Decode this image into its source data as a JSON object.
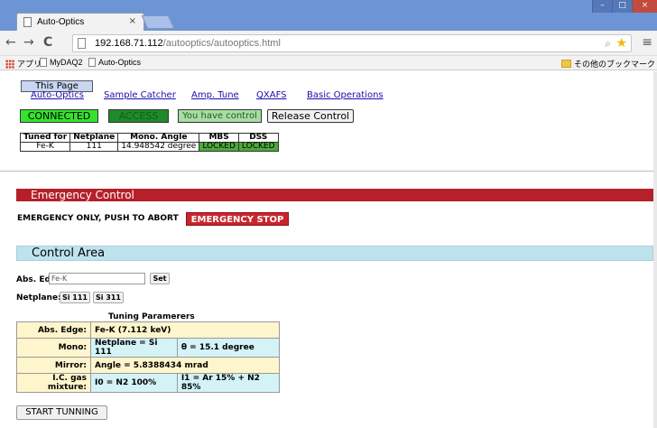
{
  "browser": {
    "tab_title": "Auto-Optics",
    "tab_close": "×",
    "url_host": "192.168.71.112",
    "url_path": "/autooptics/autooptics.html",
    "bookmarks": {
      "apps": "アプリ",
      "items": [
        "MyDAQ2",
        "Auto-Optics"
      ],
      "other": "その他のブックマーク"
    },
    "nav": {
      "back": "←",
      "forward": "→",
      "reload": "C"
    }
  },
  "page": {
    "this_page": "This Page",
    "nav_links": [
      "Auto-Optics",
      "Sample Catcher",
      "Amp. Tune",
      "QXAFS",
      "Basic Operations"
    ],
    "status": {
      "connected": "CONNECTED",
      "access": "ACCESS",
      "control": "You have control",
      "release": "Release Control"
    },
    "tuned_table": {
      "headers": [
        "Tuned for",
        "Netplane",
        "Mono. Angle",
        "MBS",
        "DSS"
      ],
      "row": [
        "Fe-K",
        "111",
        "14.948542 degree",
        "LOCKED",
        "LOCKED"
      ]
    },
    "emergency": {
      "title": "Emergency Control",
      "text": "EMERGENCY ONLY, PUSH TO ABORT",
      "button": "EMERGENCY STOP"
    },
    "control_area": {
      "title": "Control Area",
      "abs_edge_label": "Abs. Edge:",
      "abs_edge_value": "Fe-K",
      "set_button": "Set",
      "netplane_label": "Netplane:",
      "netplane_buttons": [
        "Si 111",
        "Si 311"
      ],
      "tuning_caption": "Tuning Paramerers",
      "tuning": {
        "abs_edge_label": "Abs. Edge:",
        "abs_edge_value": "Fe-K (7.112 keV)",
        "mono_label": "Mono:",
        "mono_netplane": "Netplane = Si 111",
        "mono_theta": "θ = 15.1 degree",
        "mirror_label": "Mirror:",
        "mirror_value": "Angle = 5.8388434 mrad",
        "ic_label": "I.C. gas mixture:",
        "ic_i0": "I0 = N2 100%",
        "ic_i1": "I1 = Ar 15% + N2 85%"
      },
      "start_button": "START TUNNING"
    }
  }
}
